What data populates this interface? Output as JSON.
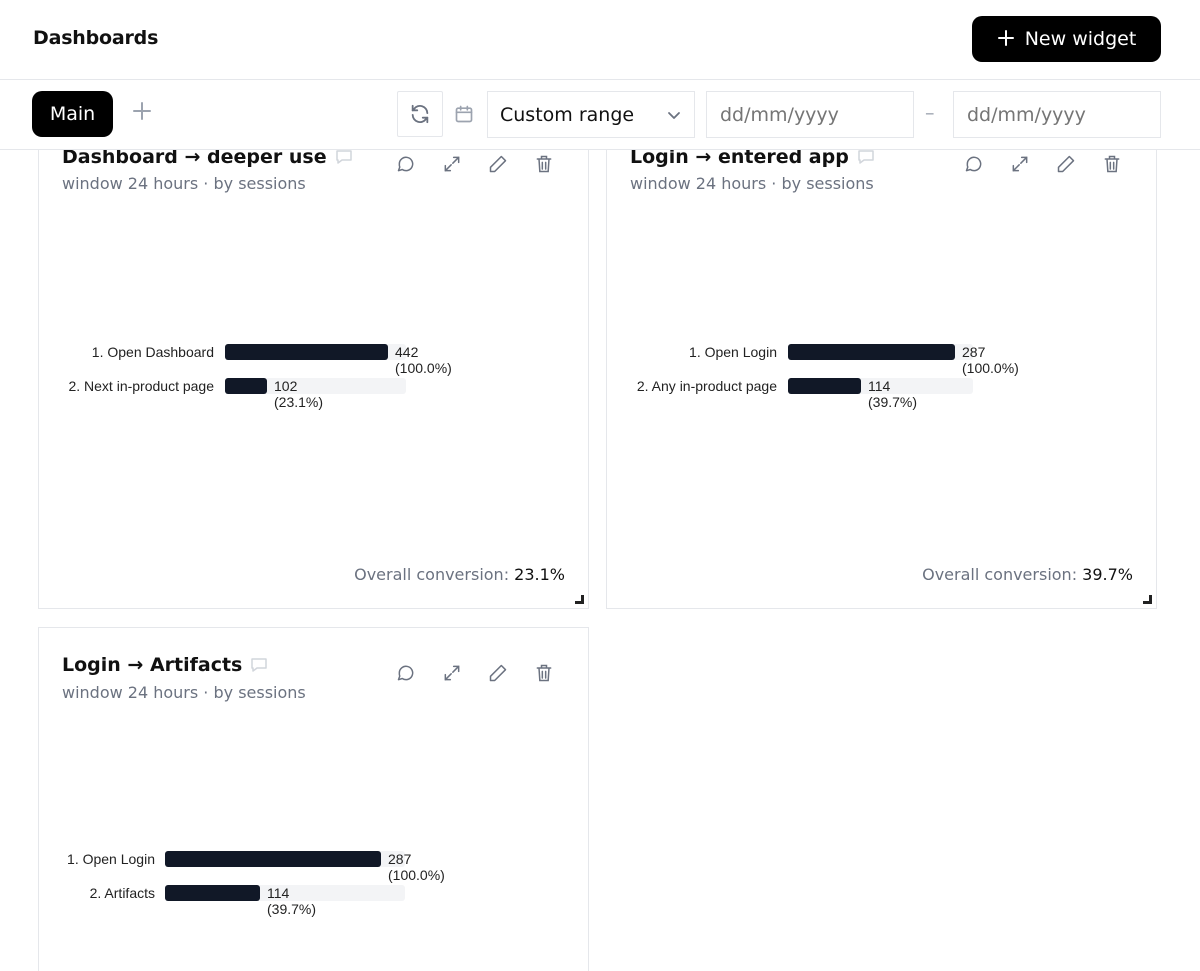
{
  "header": {
    "title": "Dashboards",
    "new_widget_label": "New widget"
  },
  "toolbar": {
    "tabs": [
      {
        "label": "Main",
        "active": true
      }
    ],
    "range_label": "Custom range",
    "date_from_placeholder": "dd/mm/yyyy",
    "date_to_placeholder": "dd/mm/yyyy",
    "date_separator": "–"
  },
  "widgets": [
    {
      "title": "Dashboard → deeper use",
      "subtitle": "window 24 hours · by sessions",
      "steps": [
        {
          "label": "1. Open Dashboard",
          "count": 442,
          "pct": 100.0,
          "value_text": "442 (100.0%)"
        },
        {
          "label": "2. Next in-product page",
          "count": 102,
          "pct": 23.1,
          "value_text": "102 (23.1%)"
        }
      ],
      "overall_label": "Overall conversion:",
      "overall_value": "23.1%"
    },
    {
      "title": "Login → entered app",
      "subtitle": "window 24 hours · by sessions",
      "steps": [
        {
          "label": "1. Open Login",
          "count": 287,
          "pct": 100.0,
          "value_text": "287 (100.0%)"
        },
        {
          "label": "2. Any in-product page",
          "count": 114,
          "pct": 39.7,
          "value_text": "114 (39.7%)"
        }
      ],
      "overall_label": "Overall conversion:",
      "overall_value": "39.7%"
    },
    {
      "title": "Login → Artifacts",
      "subtitle": "window 24 hours · by sessions",
      "steps": [
        {
          "label": "1. Open Login",
          "count": 287,
          "pct": 100.0,
          "value_text": "287 (100.0%)"
        },
        {
          "label": "2. Artifacts",
          "count": 114,
          "pct": 39.7,
          "value_text": "114 (39.7%)"
        }
      ],
      "overall_label": "",
      "overall_value": ""
    }
  ],
  "icons": [
    "plus-icon",
    "refresh-icon",
    "calendar-icon",
    "chevron-down-icon",
    "comment-icon",
    "expand-icon",
    "edit-icon",
    "trash-icon",
    "resize-handle-icon"
  ],
  "colors": {
    "primary": "#000000",
    "bar": "#111827",
    "track": "#f3f4f6",
    "muted": "#6b7280",
    "border": "#e5e7eb"
  }
}
